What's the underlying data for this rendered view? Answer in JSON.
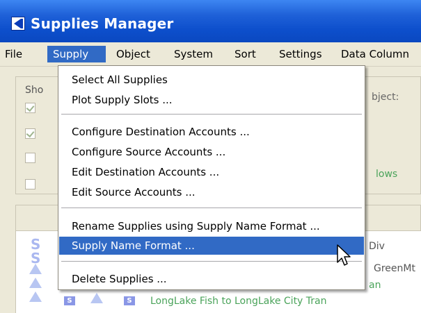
{
  "window": {
    "title": "Supplies Manager",
    "app_icon": "app-logo-icon"
  },
  "menubar": {
    "items": [
      {
        "label": "File",
        "active": false
      },
      {
        "label": "Supply",
        "active": true
      },
      {
        "label": "Object",
        "active": false
      },
      {
        "label": "System",
        "active": false
      },
      {
        "label": "Sort",
        "active": false
      },
      {
        "label": "Settings",
        "active": false
      },
      {
        "label": "Data Column",
        "active": false
      }
    ]
  },
  "background": {
    "group_label": "Sho",
    "object_label": "bject:",
    "flows_label": "lows",
    "checkboxes": [
      true,
      true,
      false,
      false
    ],
    "rows": [
      {
        "text": "Div"
      },
      {
        "text": "GreenMt"
      },
      {
        "text": "an"
      },
      {
        "badge": "S",
        "badge2": "S",
        "text": "LongLake Fish to LongLake City Tran"
      }
    ]
  },
  "dropdown": {
    "items": [
      {
        "label": "Select All Supplies"
      },
      {
        "label": "Plot Supply Slots ..."
      },
      {
        "label": "Configure Destination Accounts ..."
      },
      {
        "label": "Configure Source Accounts ..."
      },
      {
        "label": "Edit Destination Accounts ..."
      },
      {
        "label": "Edit Source Accounts ..."
      },
      {
        "label": "Rename Supplies using Supply Name Format ..."
      },
      {
        "label": "Supply Name Format ...",
        "highlighted": true
      },
      {
        "label": "Delete Supplies ..."
      }
    ]
  },
  "colors": {
    "titlebar": "#0a48c0",
    "highlight": "#316ac5",
    "menubar": "#ece9d8"
  }
}
